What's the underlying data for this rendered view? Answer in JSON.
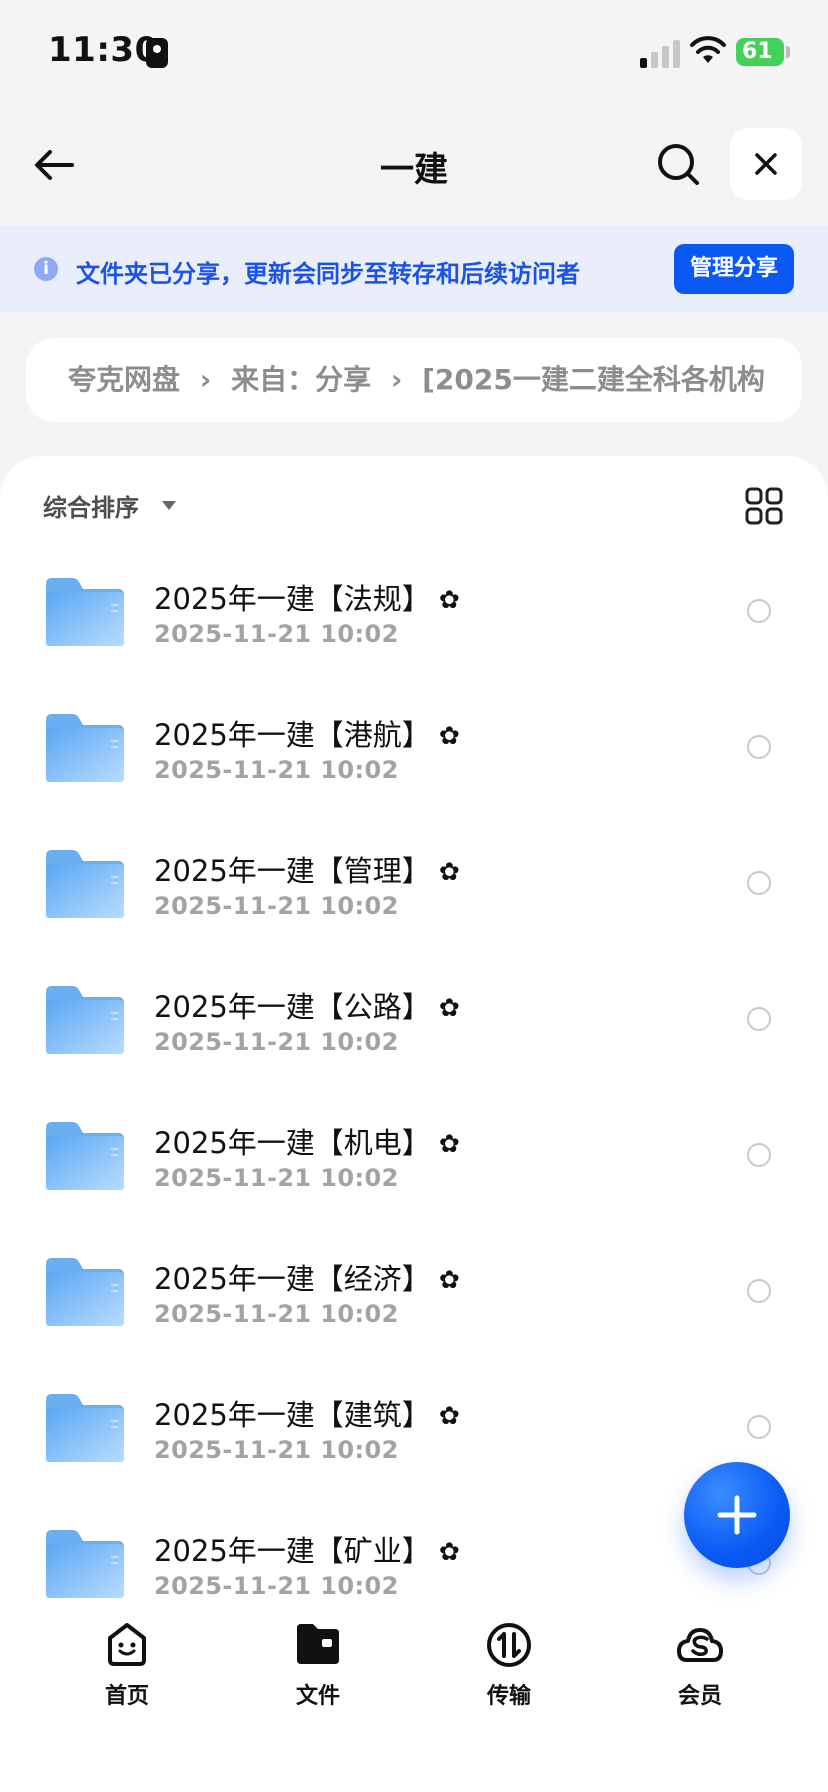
{
  "status_bar": {
    "time": "11:30",
    "battery": "61"
  },
  "nav": {
    "title": "一建"
  },
  "banner": {
    "text": "文件夹已分享，更新会同步至转存和后续访问者",
    "button_label": "管理分享"
  },
  "breadcrumb": {
    "items": [
      "夸克网盘",
      "来自：分享",
      "[2025一建二建全科各机构"
    ]
  },
  "sort": {
    "label": "综合排序"
  },
  "files": [
    {
      "name": "2025年一建【法规】",
      "date": "2025-11-21 10:02"
    },
    {
      "name": "2025年一建【港航】",
      "date": "2025-11-21 10:02"
    },
    {
      "name": "2025年一建【管理】",
      "date": "2025-11-21 10:02"
    },
    {
      "name": "2025年一建【公路】",
      "date": "2025-11-21 10:02"
    },
    {
      "name": "2025年一建【机电】",
      "date": "2025-11-21 10:02"
    },
    {
      "name": "2025年一建【经济】",
      "date": "2025-11-21 10:02"
    },
    {
      "name": "2025年一建【建筑】",
      "date": "2025-11-21 10:02"
    },
    {
      "name": "2025年一建【矿业】",
      "date": "2025-11-21 10:02"
    }
  ],
  "tabs": [
    {
      "label": "首页",
      "icon": "home-face-icon"
    },
    {
      "label": "文件",
      "icon": "folder-icon"
    },
    {
      "label": "传输",
      "icon": "transfer-icon"
    },
    {
      "label": "会员",
      "icon": "membership-icon"
    }
  ],
  "colors": {
    "accent": "#0a59f4",
    "banner_text": "#1a53e6",
    "banner_bg": "#eaeefb"
  }
}
